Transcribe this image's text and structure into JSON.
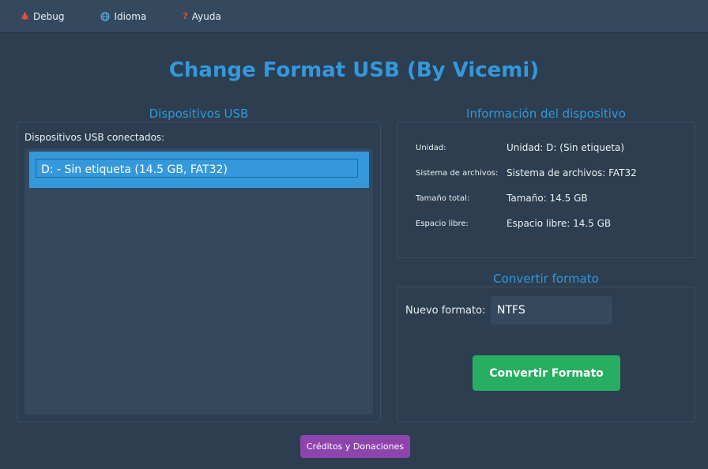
{
  "menu": {
    "items": [
      {
        "label": "Debug",
        "icon": "bug-icon"
      },
      {
        "label": "Idioma",
        "icon": "globe-icon"
      },
      {
        "label": "Ayuda",
        "icon": "question-icon"
      }
    ]
  },
  "app": {
    "title": "Change Format USB (By Vicemi)"
  },
  "usb": {
    "group_title": "Dispositivos USB",
    "caption": "Dispositivos USB conectados:",
    "devices": [
      {
        "label": "D: - Sin etiqueta (14.5 GB, FAT32)",
        "selected": true
      }
    ]
  },
  "info": {
    "group_title": "Información del dispositivo",
    "rows": [
      {
        "label": "Unidad:",
        "value": "Unidad: D: (Sin etiqueta)"
      },
      {
        "label": "Sistema de archivos:",
        "value": "Sistema de archivos: FAT32"
      },
      {
        "label": "Tamaño total:",
        "value": "Tamaño: 14.5 GB"
      },
      {
        "label": "Espacio libre:",
        "value": "Espacio libre: 14.5 GB"
      }
    ]
  },
  "convert": {
    "group_title": "Convertir formato",
    "format_label": "Nuevo formato:",
    "format_value": "NTFS",
    "button_label": "Convertir Formato"
  },
  "footer": {
    "credits_label": "Créditos y Donaciones"
  },
  "colors": {
    "background": "#2c3e50",
    "accent": "#3498db",
    "convert_button": "#27ae60",
    "credits_button": "#8e44ad"
  }
}
